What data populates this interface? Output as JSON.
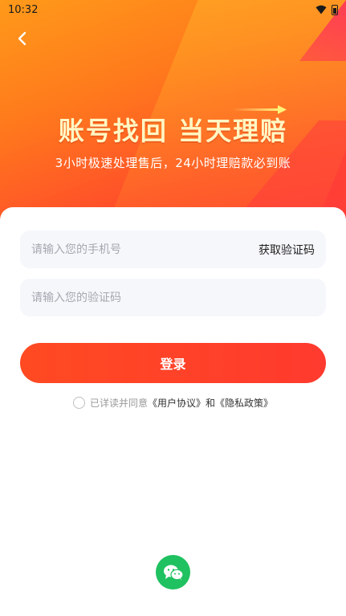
{
  "status_bar": {
    "time": "10:32",
    "icons": [
      "wifi-icon",
      "battery-icon"
    ]
  },
  "header": {
    "back_icon": "chevron-left-icon",
    "title": "账号找回 当天理赔",
    "subtitle": "3小时极速处理售后，24小时理赔款必到账"
  },
  "form": {
    "phone_placeholder": "请输入您的手机号",
    "get_code_label": "获取验证码",
    "code_placeholder": "请输入您的验证码",
    "login_label": "登录"
  },
  "agreement": {
    "prefix": "已详读并同意",
    "user_agreement": "《用户协议》",
    "and": "和",
    "privacy_policy": "《隐私政策》"
  },
  "social": {
    "wechat_icon": "wechat-icon"
  },
  "colors": {
    "accent": "#ff4a22",
    "hero_top": "#ff9a1a",
    "hero_bottom": "#ff3a34",
    "title": "#fff7c4",
    "wechat": "#1fc160",
    "field_bg": "#f6f7fb"
  }
}
